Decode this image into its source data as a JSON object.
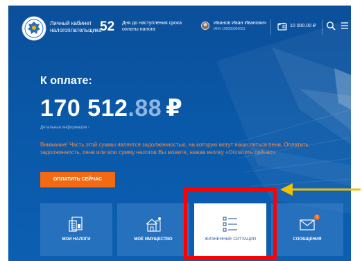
{
  "header": {
    "brand": "Личный кабинет налогоплательщика",
    "days_count": "52",
    "days_text": "Дня до наступления срока оплаты налога",
    "user_name": "Иванов Иван Иванович",
    "user_inn": "ИНН 100000000001",
    "balance": "10 000.00 ₽",
    "icons": [
      "emblem-icon",
      "avatar",
      "wallet-icon",
      "search-icon",
      "menu-icon"
    ]
  },
  "payment": {
    "label": "К оплате:",
    "amount_main": "170 512",
    "amount_cents": ".88",
    "currency": "₽",
    "details_link": "Детальная информация  ›",
    "warning": "Внимание! Часть этой суммы является задолженностью, на которую могут начисляться пени. Оплатить задолженность, пени или всю сумму налогов Вы можете, нажав кнопку «Оплатить сейчас».",
    "pay_button": "ОПЛАТИТЬ СЕЙЧАС"
  },
  "tiles": [
    {
      "label": "МОИ НАЛОГИ",
      "icon": "tax-documents-icon"
    },
    {
      "label": "МОЁ ИМУЩЕСТВО",
      "icon": "property-icon"
    },
    {
      "label": "ЖИЗНЕННЫЕ СИТУАЦИИ",
      "icon": "life-situations-list-icon"
    },
    {
      "label": "СООБЩЕНИЯ",
      "icon": "envelope-icon",
      "badge": "1"
    }
  ],
  "colors": {
    "background": "#0b4f9a",
    "accent": "#f36a13",
    "warning_text": "#ff8a3d",
    "highlight_box": "#ff0000",
    "annotation_arrow": "#f5c000",
    "tile": "#3f7fc4",
    "tile_active": "#ffffff"
  }
}
